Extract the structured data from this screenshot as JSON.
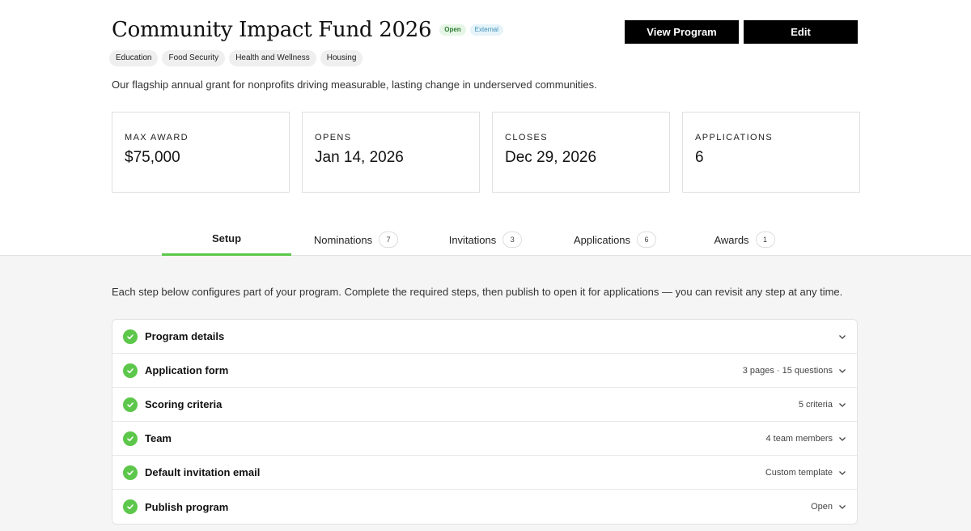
{
  "program": {
    "title": "Community Impact Fund 2026",
    "status_badge": "Open",
    "visibility_badge": "External",
    "description": "Our flagship annual grant for nonprofits driving measurable, lasting change in underserved communities.",
    "tags": [
      "Education",
      "Food Security",
      "Health and Wellness",
      "Housing"
    ]
  },
  "actions": {
    "view_label": "View Program",
    "edit_label": "Edit"
  },
  "stats": [
    {
      "label": "MAX AWARD",
      "value": "$75,000"
    },
    {
      "label": "OPENS",
      "value": "Jan 14, 2026"
    },
    {
      "label": "CLOSES",
      "value": "Dec 29, 2026"
    },
    {
      "label": "APPLICATIONS",
      "value": "6"
    }
  ],
  "tabs": [
    {
      "label": "Setup",
      "count": "",
      "active": true
    },
    {
      "label": "Nominations",
      "count": "7"
    },
    {
      "label": "Invitations",
      "count": "3"
    },
    {
      "label": "Applications",
      "count": "6"
    },
    {
      "label": "Awards",
      "count": "1"
    }
  ],
  "setup": {
    "intro": "Each step below configures part of your program. Complete the required steps, then publish to open it for applications — you can revisit any step at any time.",
    "steps": [
      {
        "name": "Program details",
        "meta": ""
      },
      {
        "name": "Application form",
        "meta": "3 pages · 15 questions"
      },
      {
        "name": "Scoring criteria",
        "meta": "5 criteria"
      },
      {
        "name": "Team",
        "meta": "4 team members"
      },
      {
        "name": "Default invitation email",
        "meta": "Custom template"
      },
      {
        "name": "Publish program",
        "meta": "Open"
      }
    ]
  },
  "icons": {
    "step_complete": "check-circle-icon",
    "expand": "chevron-down-icon"
  },
  "colors": {
    "accent_green": "#5cc74a",
    "button_bg": "#000000"
  }
}
